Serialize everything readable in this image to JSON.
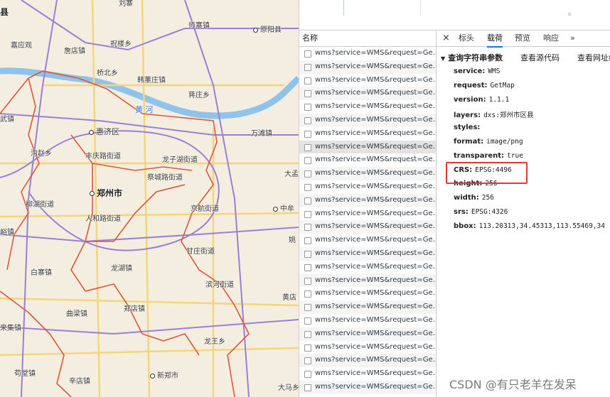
{
  "map": {
    "labels": [
      {
        "id": "liuzhai",
        "text": "刘寨"
      },
      {
        "id": "xian",
        "text": "县"
      },
      {
        "id": "shizhai",
        "text": "师寨镇"
      },
      {
        "id": "yuanyang",
        "text": "原阳县"
      },
      {
        "id": "jiaying",
        "text": "嘉应观"
      },
      {
        "id": "zhulou",
        "text": "祝楼乡"
      },
      {
        "id": "chengzhen",
        "text": "詹店镇"
      },
      {
        "id": "qiaobei",
        "text": "桥北乡"
      },
      {
        "id": "hanzhuang",
        "text": "韩董庄镇"
      },
      {
        "id": "jiangzhuang",
        "text": "蒋庄乡"
      },
      {
        "id": "wu",
        "text": "武镇"
      },
      {
        "id": "huanghe",
        "text": "黄 河"
      },
      {
        "id": "huiji",
        "text": "惠济区"
      },
      {
        "id": "wantan",
        "text": "万滩镇"
      },
      {
        "id": "gouzhao",
        "text": "沟赵乡"
      },
      {
        "id": "fengle",
        "text": "丰庆路街道"
      },
      {
        "id": "longzihu",
        "text": "龙子湖街道"
      },
      {
        "id": "jicheng",
        "text": "祭城路街道"
      },
      {
        "id": "dameng",
        "text": "大孟"
      },
      {
        "id": "zhengzhou",
        "text": "郑州市"
      },
      {
        "id": "liuhu",
        "text": "柳湖街道"
      },
      {
        "id": "renhe",
        "text": "人和路街道"
      },
      {
        "id": "jinghang",
        "text": "京航街道"
      },
      {
        "id": "zhongmu",
        "text": "中牟"
      },
      {
        "id": "yuzhen",
        "text": "峪镇"
      },
      {
        "id": "yao",
        "text": "姚"
      },
      {
        "id": "ganfu",
        "text": "甘庄街道"
      },
      {
        "id": "baizhai",
        "text": "白寨镇"
      },
      {
        "id": "longhu",
        "text": "龙湖镇"
      },
      {
        "id": "binhe",
        "text": "滨河街道"
      },
      {
        "id": "huangdian",
        "text": "黄店"
      },
      {
        "id": "zhenghan",
        "text": "郑店镇"
      },
      {
        "id": "quliang",
        "text": "曲梁镇"
      },
      {
        "id": "laiji",
        "text": "来集镇"
      },
      {
        "id": "longwang",
        "text": "龙王乡"
      },
      {
        "id": "goutang",
        "text": "苟堂镇"
      },
      {
        "id": "xinzheng",
        "text": "新郑市"
      },
      {
        "id": "xindian",
        "text": "辛店镇"
      },
      {
        "id": "dama",
        "text": "大马乡"
      }
    ]
  },
  "list": {
    "header": "名称",
    "row_text": "wms?service=WMS&request=Ge...",
    "rows": 26,
    "selected_index": 7
  },
  "details": {
    "close": "×",
    "tabs": [
      "标头",
      "载荷",
      "预览",
      "响应",
      "»"
    ],
    "active_tab": 1,
    "section_title": "查询字符串参数",
    "view_source": "查看源代码",
    "view_url": "查看网址编",
    "params": [
      {
        "key": "service:",
        "value": "WMS"
      },
      {
        "key": "request:",
        "value": "GetMap"
      },
      {
        "key": "version:",
        "value": "1.1.1"
      },
      {
        "key": "layers:",
        "value": "dxs:郑州市区县"
      },
      {
        "key": "styles:",
        "value": ""
      },
      {
        "key": "format:",
        "value": "image/png"
      },
      {
        "key": "transparent:",
        "value": "true"
      },
      {
        "key": "CRS:",
        "value": "EPSG:4496"
      },
      {
        "key": "height:",
        "value": "256"
      },
      {
        "key": "width:",
        "value": "256"
      },
      {
        "key": "srs:",
        "value": "EPSG:4326"
      },
      {
        "key": "bbox:",
        "value": "113.20313,34.45313,113.55469,34"
      }
    ]
  },
  "watermark": "CSDN @有只老羊在发呆",
  "colors": {
    "highlight": "#e53935",
    "active_tab": "#1a73e8",
    "boundary": "#e0553a",
    "ring_road": "#9b7fd6",
    "river": "#8fc3ea"
  }
}
